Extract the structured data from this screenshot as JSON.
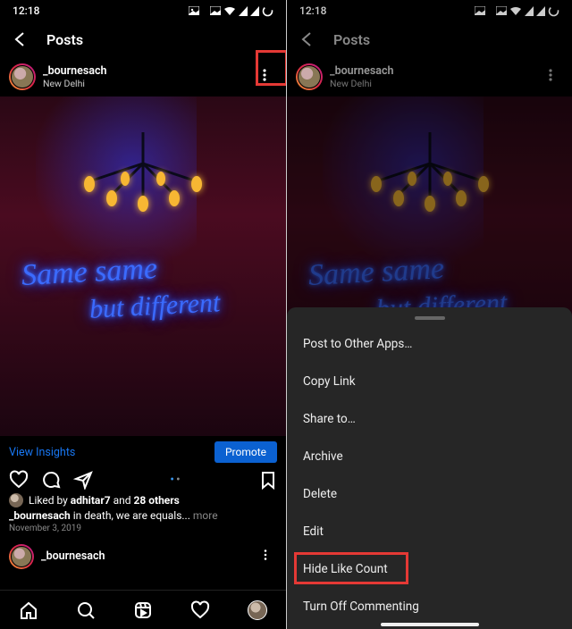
{
  "status": {
    "time": "12:18"
  },
  "appbar": {
    "title": "Posts"
  },
  "post": {
    "username": "_bournesach",
    "location": "New Delhi",
    "neon_line1": "Same same",
    "neon_line2": "but different",
    "insights": "View Insights",
    "promote": "Promote",
    "liked_prefix": "Liked by ",
    "liked_user": "adhitar7",
    "liked_mid": " and ",
    "liked_count": "28 others",
    "caption_user": "_bournesach",
    "caption_text": " in death, we are equals... ",
    "caption_more": "more",
    "date": "November 3, 2019"
  },
  "next": {
    "username": "_bournesach"
  },
  "sheet": {
    "items": [
      "Post to Other Apps…",
      "Copy Link",
      "Share to…",
      "Archive",
      "Delete",
      "Edit",
      "Hide Like Count",
      "Turn Off Commenting"
    ]
  }
}
